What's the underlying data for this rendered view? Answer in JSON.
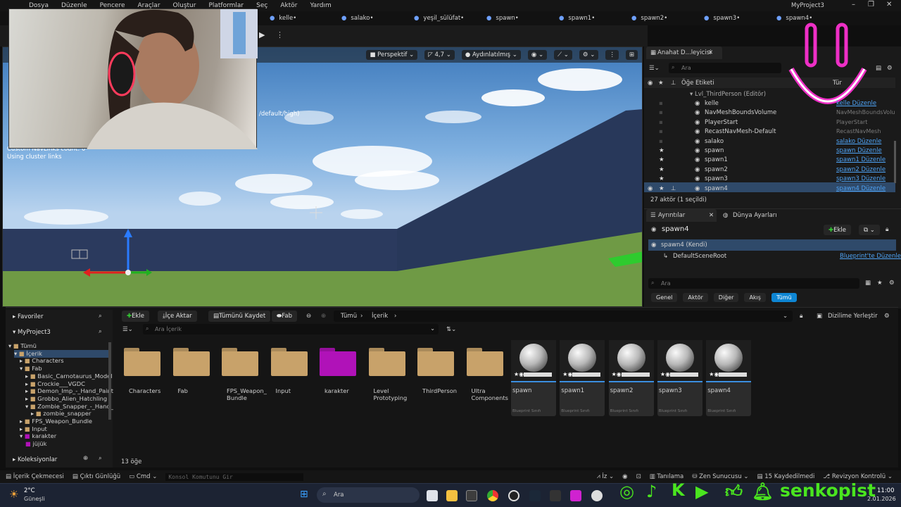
{
  "menu": [
    "Dosya",
    "Düzenle",
    "Pencere",
    "Araçlar",
    "Oluştur",
    "Platformlar",
    "Seç",
    "Aktör",
    "Yardım"
  ],
  "project_title": "MyProject3",
  "tabs": [
    "kelle•",
    "salako•",
    "yeşil_sülüfat•",
    "spawn•",
    "spawn1•",
    "spawn2•",
    "spawn3•",
    "spawn4•"
  ],
  "viewport": {
    "perspective": "Perspektif",
    "fov": "4,7",
    "lit": "Aydınlatılmış",
    "overlay_text": "/default/high)",
    "stats_lines": [
      "Custom NavLinks count: 0",
      "Using cluster links"
    ]
  },
  "outliner": {
    "tab": "Anahat D...leyicisi",
    "search_placeholder": "Ara",
    "col_label": "Öğe Etiketi",
    "col_type": "Tür",
    "level": "Lvl_ThirdPerson (Editör)",
    "rows": [
      {
        "name": "kelle",
        "type": "kelle Düzenle",
        "link": true
      },
      {
        "name": "NavMeshBoundsVolume",
        "type": "NavMeshBoundsVolu",
        "link": false
      },
      {
        "name": "PlayerStart",
        "type": "PlayerStart",
        "link": false
      },
      {
        "name": "RecastNavMesh-Default",
        "type": "RecastNavMesh",
        "link": false
      },
      {
        "name": "salako",
        "type": "salako Düzenle",
        "link": true
      },
      {
        "name": "spawn",
        "type": "spawn Düzenle",
        "link": true
      },
      {
        "name": "spawn1",
        "type": "spawn1 Düzenle",
        "link": true
      },
      {
        "name": "spawn2",
        "type": "spawn2 Düzenle",
        "link": true
      },
      {
        "name": "spawn3",
        "type": "spawn3 Düzenle",
        "link": true
      },
      {
        "name": "spawn4",
        "type": "spawn4 Düzenle",
        "link": true
      }
    ],
    "count": "27 aktör (1 seçildi)"
  },
  "details": {
    "tab1": "Ayrıntılar",
    "tab2": "Dünya Ayarları",
    "actor": "spawn4",
    "add": "Ekle",
    "self": "spawn4 (Kendi)",
    "root": "DefaultSceneRoot",
    "bp_link": "Blueprint'te Düzenle",
    "search_placeholder": "Ara",
    "filters": [
      "Genel",
      "Aktör",
      "Diğer",
      "Akış",
      "Tümü"
    ]
  },
  "content_browser": {
    "favorites": "Favoriler",
    "project": "MyProject3",
    "add": "Ekle",
    "import": "İçe Aktar",
    "save_all": "Tümünü Kaydet",
    "fab": "Fab",
    "breadcrumb": [
      "Tümü",
      "İçerik"
    ],
    "dock": "Dizilime Yerleştir",
    "search_placeholder": "Ara İçerik",
    "tree": [
      "Tümü",
      "İçerik",
      "Characters",
      "Fab",
      "Basic_Carnotaurus_Model",
      "Crockie___VGDC",
      "Demon_Imp_-_Hand_Paint",
      "Grobbo_Alien_Hatchling",
      "Zombie_Snapper_-_Hand_",
      "zombie_snapper",
      "FPS_Weapon_Bundle",
      "Input",
      "karakter",
      "jüjük"
    ],
    "collections": "Koleksiyonlar",
    "folders": [
      "Characters",
      "Fab",
      "FPS_Weapon_\nBundle",
      "Input",
      "karakter",
      "Level\nPrototyping",
      "ThirdPerson",
      "Ultra\nComponents"
    ],
    "assets": [
      "spawn",
      "spawn1",
      "spawn2",
      "spawn3",
      "spawn4"
    ],
    "asset_type": "Blueprint Sınıfı",
    "count": "13 öğe"
  },
  "statusbar": {
    "drawer": "İçerik Çekmecesi",
    "log": "Çıktı Günlüğü",
    "cmd": "Cmd",
    "console_placeholder": "Konsol Komutunu Gir",
    "trace": "İz",
    "derive": "Tanılama",
    "zen": "Zen Sunucusu",
    "saved": "15 Kaydedilmedi",
    "revision": "Revizyon Kontrolü"
  },
  "taskbar": {
    "weather_temp": "2°C",
    "weather_desc": "Güneşli",
    "search": "Ara",
    "time": "11:00",
    "date": "2.01.2026"
  },
  "overlay": {
    "brand": "senkopist"
  },
  "colors": {
    "accent": "#0e86d4",
    "link": "#4ea3f5",
    "folder": "#c8a26a",
    "karakter_folder": "#b012b8",
    "brand_green": "#4ae51f",
    "logo_pink": "#ee2fc6"
  }
}
